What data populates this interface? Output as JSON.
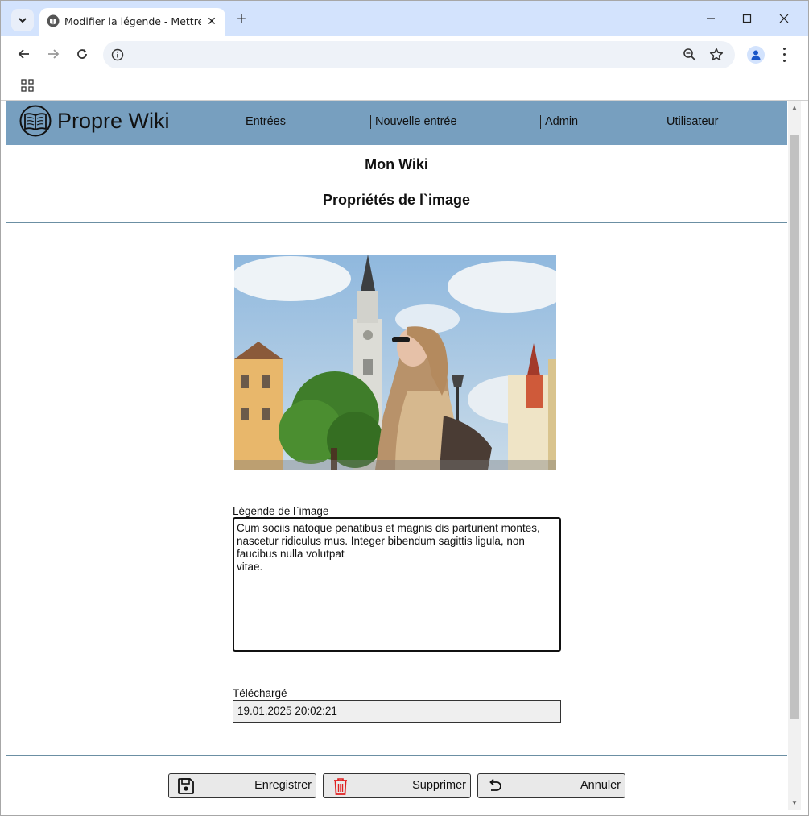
{
  "browser": {
    "tab_title": "Modifier la légende - Mettre à jour",
    "address": ""
  },
  "site": {
    "brand": "Propre Wiki",
    "nav": [
      {
        "label": "Entrées"
      },
      {
        "label": "Nouvelle entrée"
      },
      {
        "label": "Admin"
      },
      {
        "label": "Utilisateur"
      }
    ]
  },
  "page": {
    "wiki_title": "Mon Wiki",
    "title": "Propriétés de l`image",
    "caption_label": "Légende de l`image",
    "caption_value": "Cum sociis natoque penatibus et magnis dis parturient montes, nascetur ridiculus mus. Integer bibendum sagittis ligula, non faucibus nulla volutpat\nvitae.",
    "uploaded_label": "Téléchargé",
    "uploaded_value": "19.01.2025 20:02:21"
  },
  "actions": {
    "save": "Enregistrer",
    "delete": "Supprimer",
    "cancel": "Annuler"
  },
  "colors": {
    "header_bg": "#779fbf",
    "delete_icon": "#e02020",
    "divider": "#6b8fa3"
  }
}
